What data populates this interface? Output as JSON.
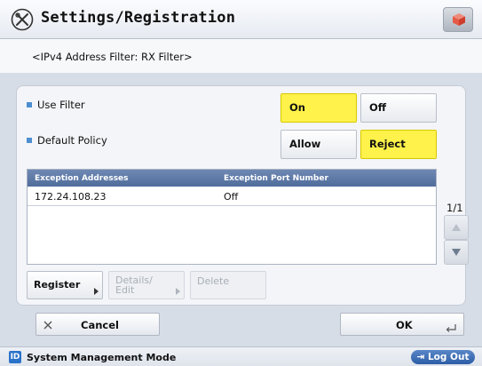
{
  "header": {
    "title": "Settings/Registration"
  },
  "subtitle": "<IPv4 Address Filter: RX Filter>",
  "use_filter": {
    "label": "Use Filter",
    "on": "On",
    "off": "Off",
    "selected": "On"
  },
  "default_policy": {
    "label": "Default Policy",
    "allow": "Allow",
    "reject": "Reject",
    "selected": "Reject"
  },
  "table": {
    "columns": [
      "Exception Addresses",
      "Exception Port Number"
    ],
    "rows": [
      {
        "address": "172.24.108.23",
        "port": "Off"
      }
    ]
  },
  "pagination": "1/1",
  "table_buttons": {
    "register": "Register",
    "details_edit_line1": "Details/",
    "details_edit_line2": "Edit",
    "delete": "Delete"
  },
  "actions": {
    "cancel": "Cancel",
    "ok": "OK"
  },
  "statusbar": {
    "mode_icon": "ID",
    "mode": "System Management Mode",
    "logout": "Log Out"
  },
  "colors": {
    "selected": "#fff24a",
    "accent": "#4d8ed1",
    "table_header": "#4f6c9b"
  }
}
